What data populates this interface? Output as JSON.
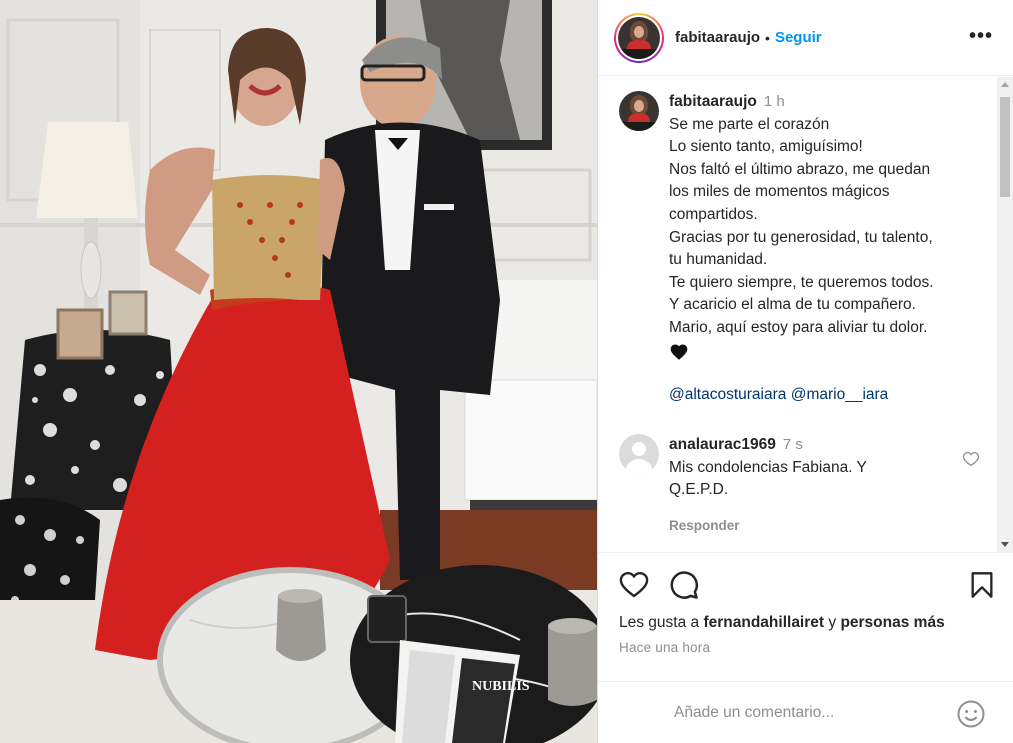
{
  "post": {
    "username": "fabitaaraujo",
    "separator": "•",
    "follow_label": "Seguir",
    "more_label": "•••",
    "time": "1 h",
    "caption_lines": [
      "Se me parte el corazón",
      "Lo siento tanto, amiguísimo!",
      "Nos faltó el último abrazo, me quedan",
      "los miles de momentos mágicos",
      "compartidos.",
      "Gracias por tu generosidad, tu talento,",
      "tu humanidad.",
      "Te quiero siempre, te queremos todos.",
      "Y acaricio el alma de tu compañero.",
      "Mario, aquí estoy para aliviar tu dolor."
    ],
    "caption_emoji": "black-heart",
    "mentions": [
      "@altacosturaiara",
      "@mario__iara"
    ]
  },
  "comments": [
    {
      "username": "analaurac1969",
      "time": "7 s",
      "text_lines": [
        "Mis condolencias Fabiana. Y",
        "Q.E.P.D."
      ],
      "reply_label": "Responder"
    }
  ],
  "likes": {
    "prefix": "Les gusta a",
    "user": "fernandahillairet",
    "middle": "y",
    "suffix": "personas más"
  },
  "timestamp": "Hace una hora",
  "add_comment": {
    "placeholder": "Añade un comentario..."
  },
  "photo": {
    "book_title": "NUBILIS"
  },
  "colors": {
    "accent_blue": "#0095f6",
    "mention_blue": "#00376b",
    "muted": "#8e8e8e",
    "text": "#262626",
    "dress_red": "#d4211f"
  },
  "icons": [
    "more-icon",
    "heart-icon",
    "comment-icon",
    "save-icon",
    "emoji-icon",
    "like-comment-icon"
  ]
}
